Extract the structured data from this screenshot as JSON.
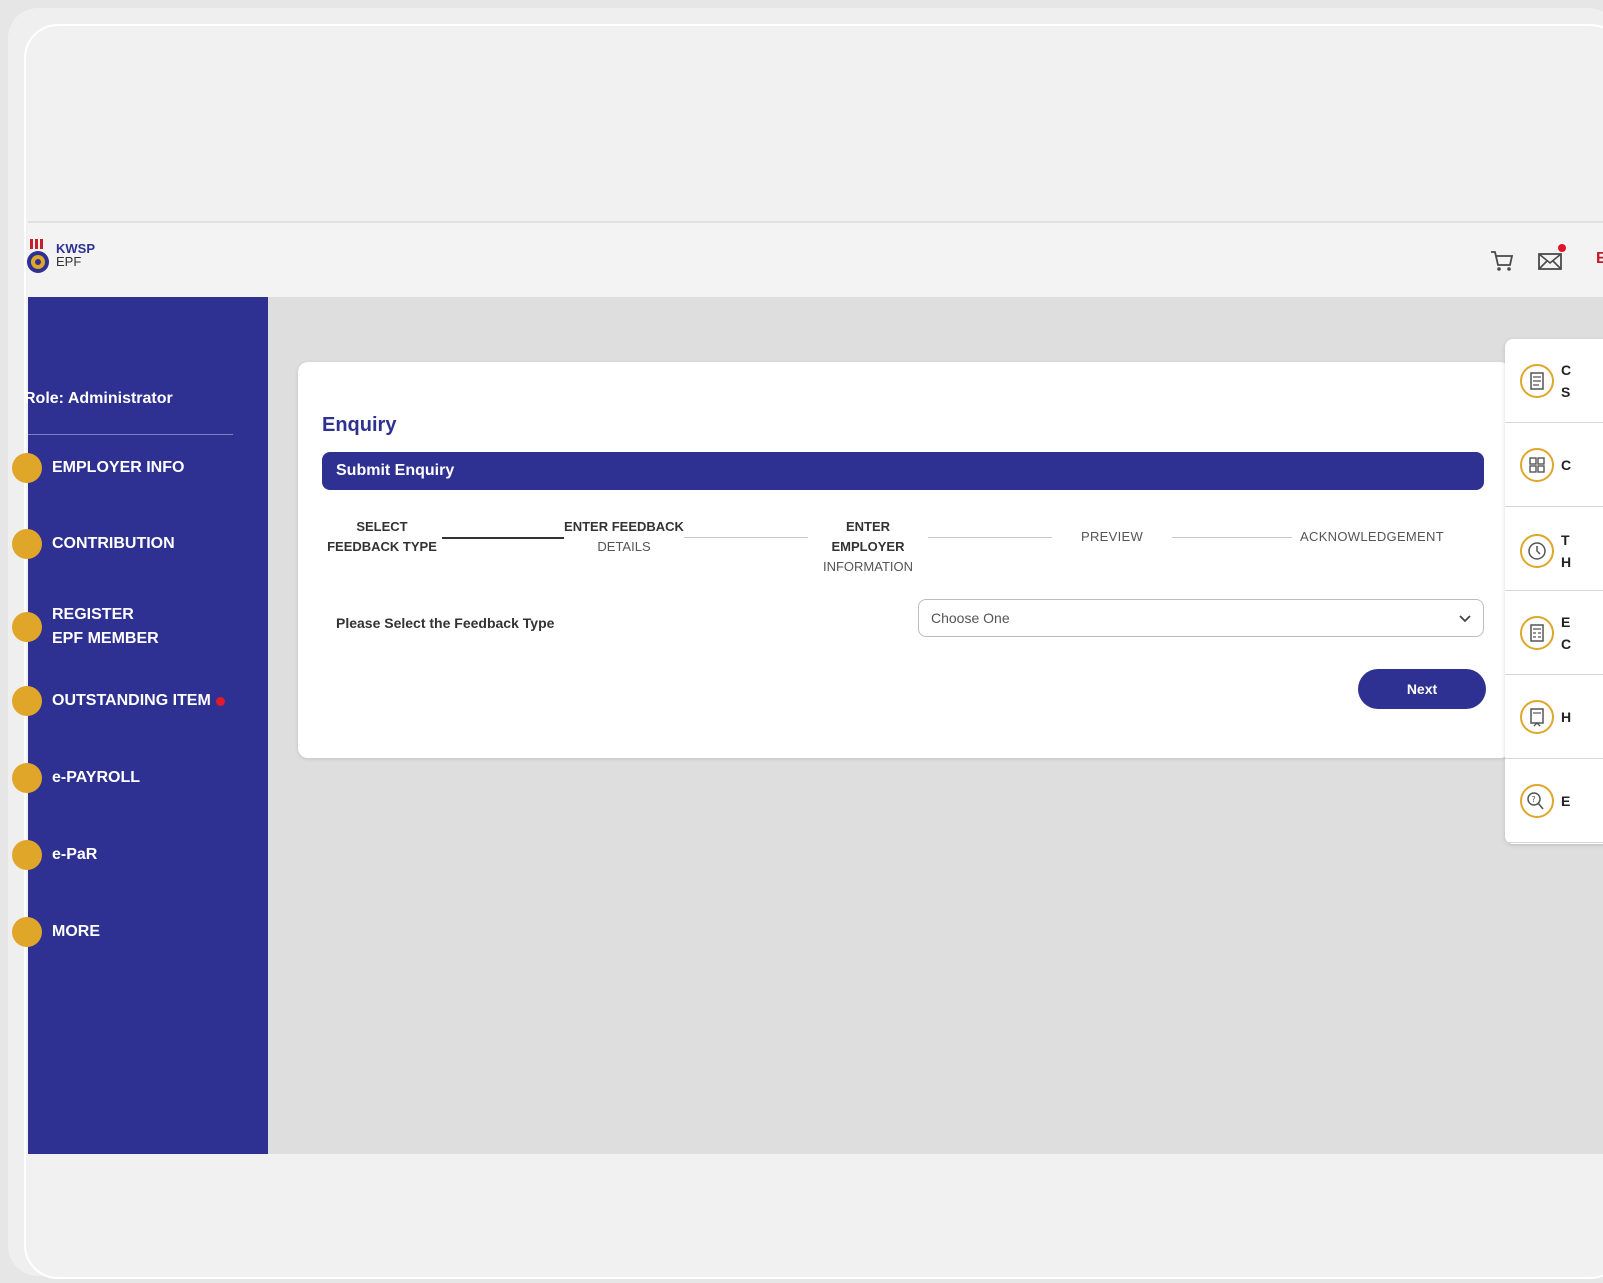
{
  "header": {
    "logo_line1": "KWSP",
    "logo_line2": "EPF",
    "truncated_link": "E"
  },
  "sidebar": {
    "role": "Role: Administrator",
    "items": [
      {
        "label": "EMPLOYER INFO"
      },
      {
        "label": "CONTRIBUTION"
      },
      {
        "label": "REGISTER EPF MEMBER"
      },
      {
        "label": "OUTSTANDING ITEM",
        "has_alert": true
      },
      {
        "label": "e-PAYROLL"
      },
      {
        "label": "e-PaR"
      },
      {
        "label": "MORE"
      }
    ]
  },
  "enquiry": {
    "title": "Enquiry",
    "section_title": "Submit Enquiry",
    "steps": [
      {
        "line1": "SELECT",
        "line2": "FEEDBACK TYPE",
        "active": true
      },
      {
        "line1": "ENTER FEEDBACK",
        "line2": "DETAILS"
      },
      {
        "line1": "ENTER EMPLOYER",
        "line2": "INFORMATION"
      },
      {
        "line1": "PREVIEW",
        "line2": ""
      },
      {
        "line1": "ACKNOWLEDGEMENT",
        "line2": ""
      }
    ],
    "feedback_label": "Please Select the Feedback Type",
    "select_value": "Choose One",
    "next_label": "Next"
  },
  "quick_links": [
    {
      "line1": "C",
      "line2": "S",
      "icon": "document-icon"
    },
    {
      "line1": "C",
      "line2": "",
      "icon": "grid-icon"
    },
    {
      "line1": "T",
      "line2": "H",
      "icon": "clock-icon"
    },
    {
      "line1": "E",
      "line2": "C",
      "icon": "calculator-icon"
    },
    {
      "line1": "H",
      "line2": "",
      "icon": "help-icon"
    },
    {
      "line1": "E",
      "line2": "",
      "icon": "enquiry-icon"
    }
  ],
  "colors": {
    "primary": "#2e3191",
    "accent": "#dfa62a",
    "alert": "#e21a2c"
  }
}
